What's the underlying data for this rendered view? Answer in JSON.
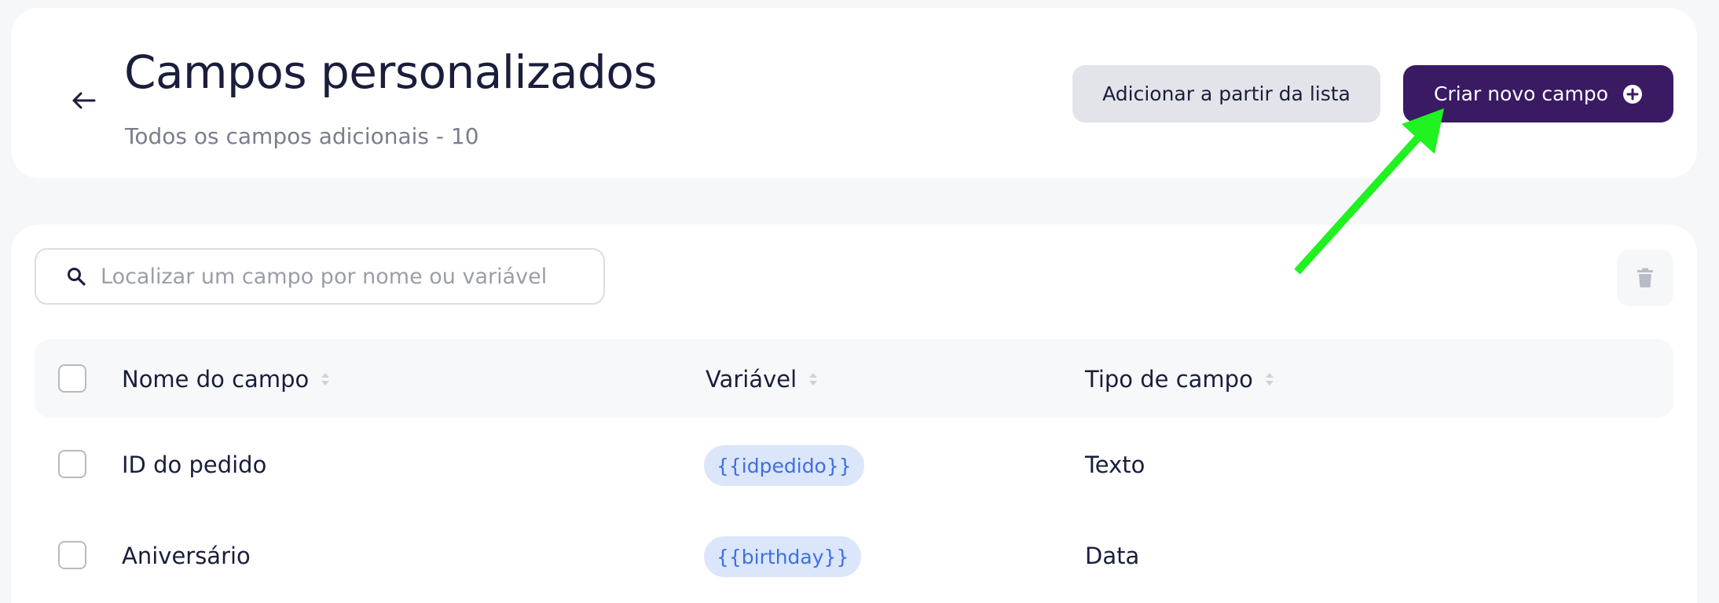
{
  "header": {
    "title": "Campos personalizados",
    "subtitle": "Todos os campos adicionais - 10",
    "add_from_list_label": "Adicionar a partir da lista",
    "create_new_label": "Criar novo campo"
  },
  "search": {
    "placeholder": "Localizar um campo por nome ou variável",
    "value": ""
  },
  "table": {
    "columns": [
      "Nome do campo",
      "Variável",
      "Tipo de campo"
    ],
    "rows": [
      {
        "name": "ID do pedido",
        "variable": "{{idpedido}}",
        "type": "Texto"
      },
      {
        "name": "Aniversário",
        "variable": "{{birthday}}",
        "type": "Data"
      }
    ]
  },
  "icons": {
    "back": "arrow-left-icon",
    "plus": "plus-circle-icon",
    "search": "search-icon",
    "trash": "trash-icon",
    "sort": "sort-icon"
  },
  "colors": {
    "primary": "#3a1a63",
    "secondary_button": "#e2e4ea",
    "badge_bg": "#dbe6fb",
    "badge_text": "#3d6fe0",
    "annotation_arrow": "#1ff21f"
  }
}
